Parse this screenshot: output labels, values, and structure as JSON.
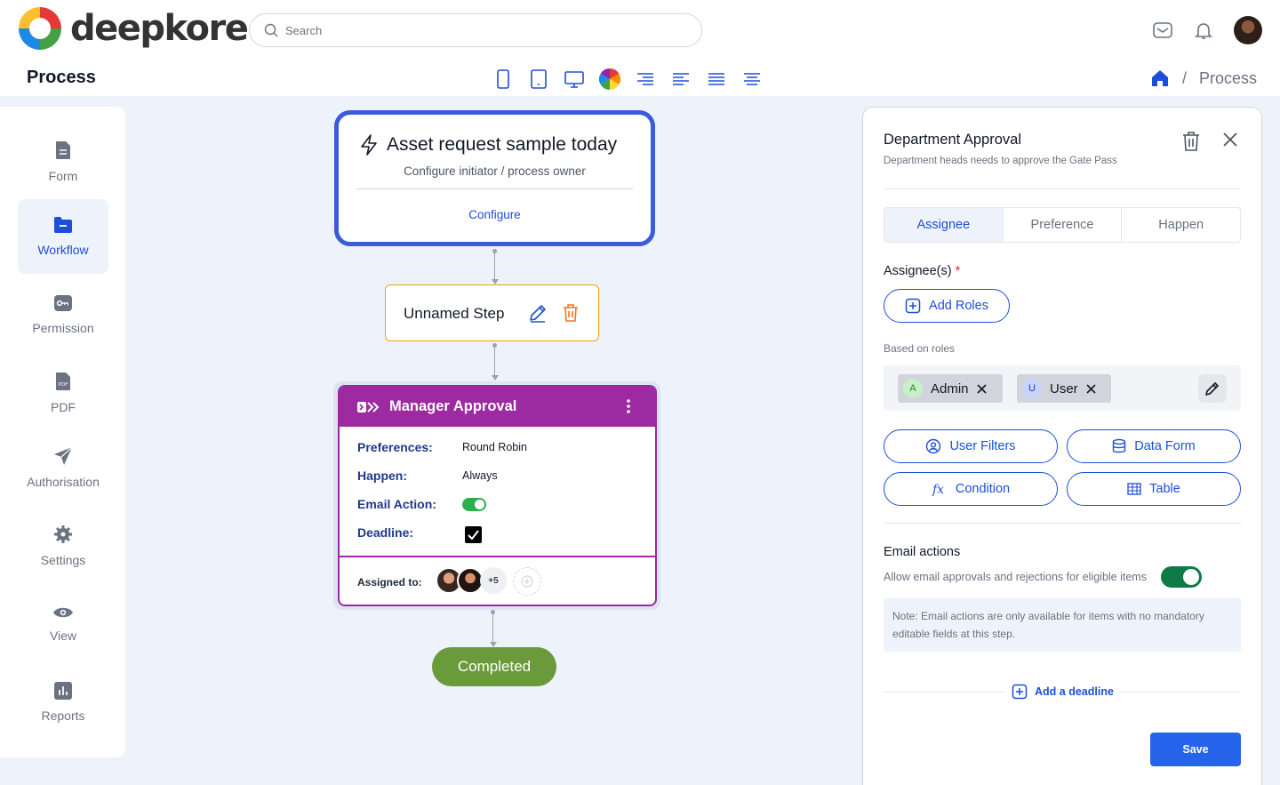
{
  "brand": {
    "name": "deepkore"
  },
  "search": {
    "placeholder": "Search"
  },
  "header": {
    "page_title": "Process",
    "breadcrumb_current": "Process",
    "breadcrumb_separator": "/"
  },
  "sidebar": {
    "items": [
      {
        "label": "Form",
        "icon": "form-icon",
        "active": false
      },
      {
        "label": "Workflow",
        "icon": "folder-icon",
        "active": true
      },
      {
        "label": "Permission",
        "icon": "key-icon",
        "active": false
      },
      {
        "label": "PDF",
        "icon": "pdf-icon",
        "active": false
      },
      {
        "label": "Authorisation",
        "icon": "send-icon",
        "active": false
      },
      {
        "label": "Settings",
        "icon": "gear-icon",
        "active": false
      },
      {
        "label": "View",
        "icon": "eye-icon",
        "active": false
      },
      {
        "label": "Reports",
        "icon": "chart-icon",
        "active": false
      }
    ]
  },
  "flow": {
    "start": {
      "title": "Asset request sample today",
      "subtitle": "Configure initiator / process owner",
      "action": "Configure"
    },
    "step": {
      "label": "Unnamed Step"
    },
    "manager": {
      "title": "Manager Approval",
      "rows": [
        {
          "label": "Preferences:",
          "value": "Round Robin"
        },
        {
          "label": "Happen:",
          "value": "Always"
        },
        {
          "label": "Email Action:",
          "value": ""
        },
        {
          "label": "Deadline:",
          "value": ""
        }
      ],
      "email_action_enabled": true,
      "deadline_checked": true,
      "assigned_label": "Assigned to:",
      "assigned_more": "+5"
    },
    "end": {
      "label": "Completed"
    }
  },
  "panel": {
    "title": "Department Approval",
    "subtitle": "Department heads needs to approve the Gate Pass",
    "tabs": [
      {
        "label": "Assignee",
        "active": true
      },
      {
        "label": "Preference",
        "active": false
      },
      {
        "label": "Happen",
        "active": false
      }
    ],
    "assignee_label": "Assignee(s)",
    "required_mark": "*",
    "add_roles": "Add Roles",
    "based_on_roles": "Based on roles",
    "roles": [
      {
        "initial": "A",
        "name": "Admin",
        "color": "#c8f0c8",
        "text_color": "#2e7d32"
      },
      {
        "initial": "U",
        "name": "User",
        "color": "#c7d2fe",
        "text_color": "#3730a3"
      }
    ],
    "buttons": {
      "user_filters": "User Filters",
      "data_form": "Data Form",
      "condition": "Condition",
      "table": "Table"
    },
    "email_actions_title": "Email actions",
    "email_actions_sub": "Allow email approvals and rejections for eligible items",
    "email_actions_enabled": true,
    "note": "Note: Email actions are only available for items with no mandatory editable fields at this step.",
    "add_deadline": "Add a deadline",
    "save": "Save"
  },
  "colors": {
    "primary": "#1d4ed8",
    "start_border": "#3b5bdb",
    "step_border": "#f59e0b",
    "manager": "#9c2aa0",
    "completed": "#6b9a3a",
    "toggle_on": "#0e7a45"
  }
}
